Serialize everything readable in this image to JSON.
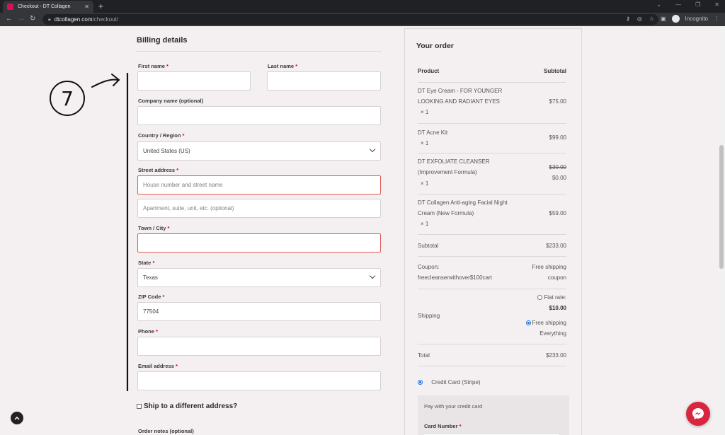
{
  "browser": {
    "tab_title": "Checkout - DT Collagen",
    "url_host": "dtcollagen.com",
    "url_path": "/checkout/",
    "profile_label": "Incognito"
  },
  "billing": {
    "title": "Billing details",
    "first_name_label": "First name",
    "last_name_label": "Last name",
    "company_label": "Company name (optional)",
    "country_label": "Country / Region",
    "country_value": "United States (US)",
    "street_label": "Street address",
    "street_placeholder": "House number and street name",
    "street2_placeholder": "Apartment, suite, unit, etc. (optional)",
    "city_label": "Town / City",
    "state_label": "State",
    "state_value": "Texas",
    "zip_label": "ZIP Code",
    "zip_value": "77504",
    "phone_label": "Phone",
    "email_label": "Email address",
    "required_mark": "*",
    "ship_different": "Ship to a different address?",
    "order_notes_label": "Order notes (optional)"
  },
  "order": {
    "title": "Your order",
    "col_product": "Product",
    "col_subtotal": "Subtotal",
    "items": [
      {
        "name_line1": "DT Eye Cream - FOR YOUNGER",
        "name_line2": "LOOKING AND RADIANT EYES",
        "qty": "× 1",
        "price": "$75.00"
      },
      {
        "name_line1": "DT Acne Kit",
        "qty": "× 1",
        "price": "$99.00"
      },
      {
        "name_line1": "DT EXFOLIATE CLEANSER",
        "name_line2": "(Improvement Formula)",
        "qty": "× 1",
        "old_price": "$30.00",
        "price": "$0.00"
      },
      {
        "name_line1": "DT Collagen Anti-aging Facial Night",
        "name_line2": "Cream (New Formula)",
        "qty": "× 1",
        "price": "$59.00"
      }
    ],
    "subtotal_label": "Subtotal",
    "subtotal_value": "$233.00",
    "coupon_label_1": "Coupon:",
    "coupon_label_2": "freecleanserwithover$100cart",
    "coupon_value_1": "Free shipping",
    "coupon_value_2": "coupon",
    "shipping_label": "Shipping",
    "flat_rate_label": "Flat rate:",
    "flat_rate_value": "$10.00",
    "free_shipping_1": "Free shipping",
    "free_shipping_2": "Everything",
    "total_label": "Total",
    "total_value": "$233.00",
    "payment_method": "Credit Card (Stripe)",
    "payment_desc": "Pay with your credit card",
    "card_number_label": "Card Number"
  },
  "annotation": {
    "number": "7"
  }
}
